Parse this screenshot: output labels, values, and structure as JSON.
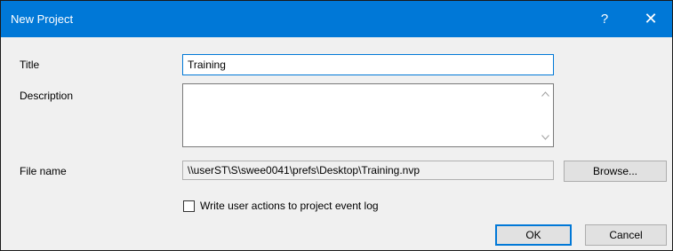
{
  "window": {
    "title": "New Project",
    "help_glyph": "?",
    "close_glyph": "✕"
  },
  "form": {
    "title_label": "Title",
    "title_value": "Training",
    "description_label": "Description",
    "description_value": "",
    "file_name_label": "File name",
    "file_name_value": "\\\\userST\\S\\swee0041\\prefs\\Desktop\\Training.nvp",
    "browse_label": "Browse...",
    "log_checkbox_label": "Write user actions to project event log",
    "log_checkbox_checked": false
  },
  "buttons": {
    "ok_label": "OK",
    "cancel_label": "Cancel"
  },
  "icons": {
    "help": "question-icon",
    "close": "close-icon",
    "scroll_up": "chevron-up-icon",
    "scroll_down": "chevron-down-icon"
  },
  "colors": {
    "titlebar": "#0078d7",
    "dialog_bg": "#f0f0f0",
    "focus_border": "#0078d7"
  }
}
